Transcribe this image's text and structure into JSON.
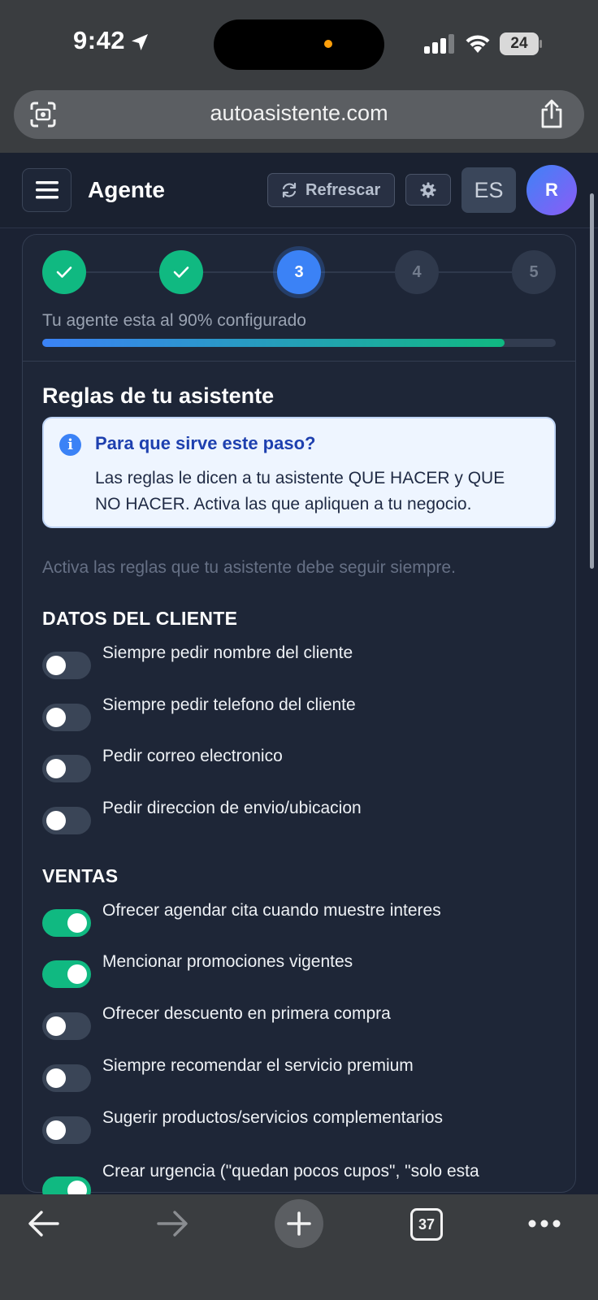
{
  "status_bar": {
    "time": "9:42",
    "battery": "24"
  },
  "browser": {
    "url": "autoasistente.com",
    "tab_count": "37"
  },
  "header": {
    "title": "Agente",
    "refresh_label": "Refrescar",
    "language": "ES",
    "avatar_initial": "R"
  },
  "stepper": {
    "steps": [
      {
        "label": "",
        "state": "done"
      },
      {
        "label": "",
        "state": "done"
      },
      {
        "label": "3",
        "state": "current"
      },
      {
        "label": "4",
        "state": "pending"
      },
      {
        "label": "5",
        "state": "pending"
      }
    ],
    "progress_text": "Tu agente esta al 90% configurado",
    "progress_fraction": 0.9
  },
  "section": {
    "title": "Reglas de tu asistente",
    "info_title": "Para que sirve este paso?",
    "info_text": "Las reglas le dicen a tu asistente QUE HACER y QUE NO HACER. Activa las que apliquen a tu negocio.",
    "hint": "Activa las reglas que tu asistente debe seguir siempre."
  },
  "groups": [
    {
      "title": "DATOS DEL CLIENTE",
      "rules": [
        {
          "label": "Siempre pedir nombre del cliente",
          "enabled": false
        },
        {
          "label": "Siempre pedir telefono del cliente",
          "enabled": false
        },
        {
          "label": "Pedir correo electronico",
          "enabled": false
        },
        {
          "label": "Pedir direccion de envio/ubicacion",
          "enabled": false
        }
      ]
    },
    {
      "title": "VENTAS",
      "rules": [
        {
          "label": "Ofrecer agendar cita cuando muestre interes",
          "enabled": true
        },
        {
          "label": "Mencionar promociones vigentes",
          "enabled": true
        },
        {
          "label": "Ofrecer descuento en primera compra",
          "enabled": false
        },
        {
          "label": "Siempre recomendar el servicio premium",
          "enabled": false
        },
        {
          "label": "Sugerir productos/servicios complementarios",
          "enabled": false
        },
        {
          "label": "Crear urgencia (\"quedan pocos cupos\", \"solo esta",
          "enabled": true
        }
      ]
    }
  ],
  "colors": {
    "accent": "#3b82f6",
    "success": "#10b981",
    "background": "#1b2233",
    "card": "#1e2637"
  }
}
